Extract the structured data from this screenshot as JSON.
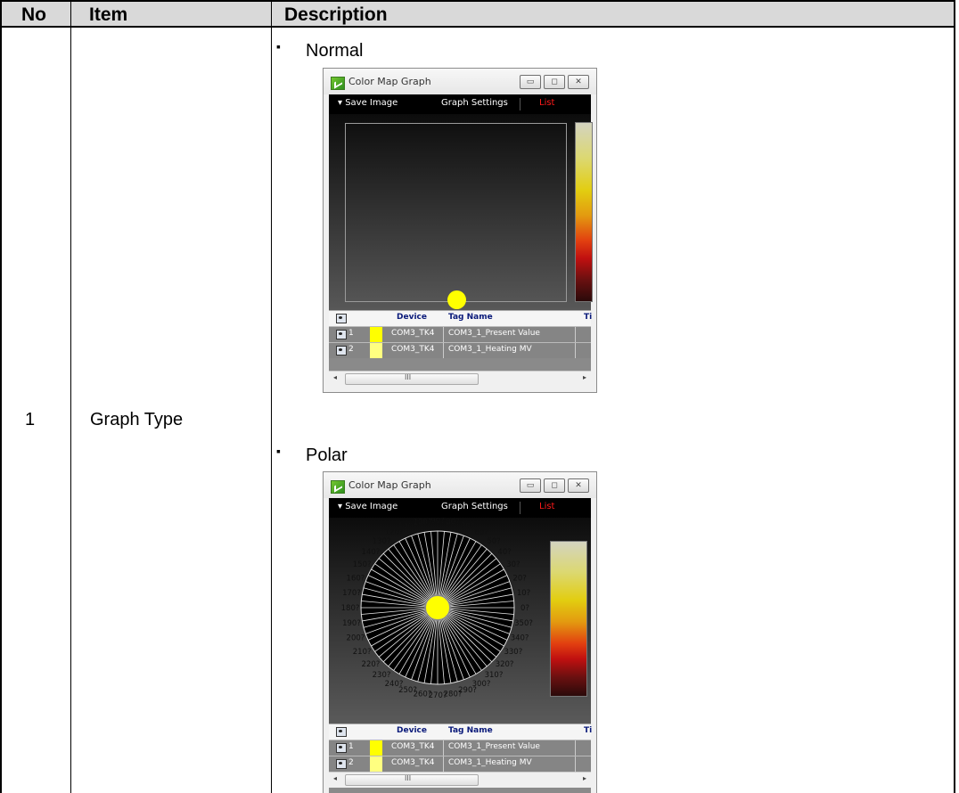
{
  "table": {
    "headers": {
      "no": "No",
      "item": "Item",
      "description": "Description"
    },
    "row": {
      "no": "1",
      "item": "Graph Type"
    }
  },
  "sections": [
    {
      "label": "Normal"
    },
    {
      "label": "Polar"
    }
  ],
  "window": {
    "title": "Color Map Graph",
    "buttons": {
      "minimize": "▭",
      "restore": "◻",
      "close": "✕"
    },
    "toolbar": {
      "save_image": "▾  Save Image",
      "graph_settings": "Graph Settings",
      "list": "List"
    },
    "grid": {
      "headers": {
        "device": "Device",
        "tag_name": "Tag Name",
        "time": "Ti"
      },
      "rows": [
        {
          "index": "1",
          "device": "COM3_TK4",
          "tag": "COM3_1_Present Value",
          "color": "#ffff00"
        },
        {
          "index": "2",
          "device": "COM3_TK4",
          "tag": "COM3_1_Heating MV",
          "color": "#ffff80"
        }
      ],
      "scroll_grip": "III"
    },
    "accent": {
      "point": "#ffff00",
      "list_text": "#ff1a1a"
    },
    "polar_angle_labels": [
      "0?",
      "10?",
      "20?",
      "30?",
      "40?",
      "50?",
      "60?",
      "70?",
      "80?",
      "90?",
      "100?",
      "110?",
      "120?",
      "130?",
      "140?",
      "150?",
      "160?",
      "170?",
      "180?",
      "190?",
      "200?",
      "210?",
      "220?",
      "230?",
      "240?",
      "250?",
      "260?",
      "270?",
      "280?",
      "290?",
      "300?",
      "310?",
      "320?",
      "330?",
      "340?",
      "350?"
    ]
  }
}
